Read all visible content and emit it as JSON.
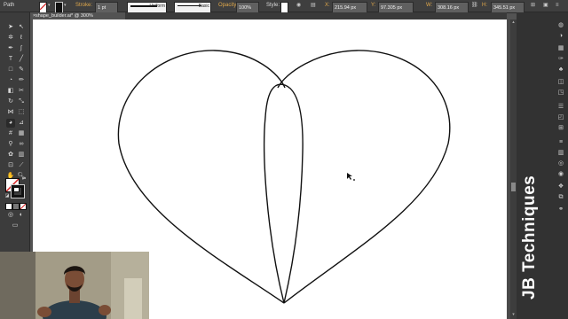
{
  "control_bar": {
    "selection_type": "Path",
    "stroke_label": "Stroke:",
    "stroke_weight": "1 pt",
    "profile": "Uniform",
    "brush": "Basic",
    "opacity_label": "Opacity:",
    "opacity_value": "100%",
    "style_label": "Style:",
    "x_label": "X:",
    "x_value": "215.94 px",
    "y_label": "Y:",
    "y_value": "97.305 px",
    "w_label": "W:",
    "w_value": "308.16 px",
    "h_label": "H:",
    "h_value": "345.51 px"
  },
  "document": {
    "tab_title": "shape_builder.ai* @ 300% (CMYK/Preview)",
    "close_glyph": "×"
  },
  "tools": {
    "icons": [
      "selection-tool",
      "direct-selection-tool",
      "magic-wand-tool",
      "lasso-tool",
      "pen-tool",
      "curvature-tool",
      "type-tool",
      "line-tool",
      "rectangle-tool",
      "paintbrush-tool",
      "shaper-tool",
      "pencil-tool",
      "eraser-tool",
      "rotate-tool",
      "scale-tool",
      "width-tool",
      "shape-builder-tool",
      "free-transform-tool",
      "perspective-tool",
      "mesh-tool",
      "gradient-tool",
      "eyedropper-tool",
      "blend-tool",
      "symbol-sprayer-tool",
      "column-graph-tool",
      "artboard-tool",
      "slice-tool",
      "hand-tool",
      "zoom-tool"
    ]
  },
  "colors": {
    "ui_dark": "#323232",
    "canvas": "#535353",
    "artboard": "#ffffff",
    "accent_label": "#e0a84b",
    "fill_none_slash": "#d42020"
  },
  "right_panel": {
    "icons": [
      "color-panel-icon",
      "color-guide-icon",
      "swatches-icon",
      "brushes-icon",
      "symbols-icon",
      "graphic-styles-icon",
      "appearance-icon",
      "align-icon",
      "pathfinder-icon",
      "transform-icon",
      "stroke-icon",
      "gradient-icon",
      "transparency-icon",
      "layers-icon",
      "artboards-icon",
      "links-icon",
      "properties-icon"
    ]
  },
  "watermark": "JB Techniques"
}
